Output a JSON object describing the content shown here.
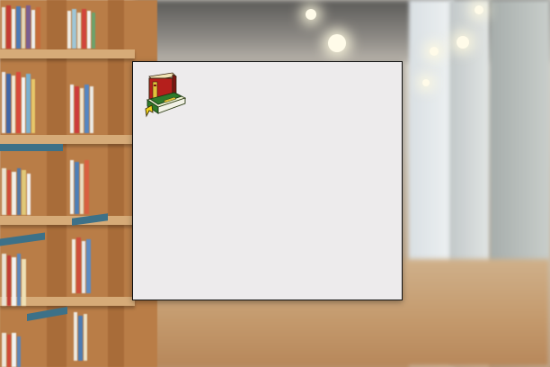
{
  "scene": {
    "background": "blurred-library-interior",
    "panel_background": "#edebec",
    "panel_border": "#111111"
  },
  "icons": {
    "app_icon": "stacked-books-icon"
  },
  "colors": {
    "red_book": "#b51f1c",
    "green_book": "#2f7a2b",
    "bookmark": "#f2d21b",
    "shelf_wood": "#b97d47",
    "shelf_edge": "#3d7188"
  }
}
